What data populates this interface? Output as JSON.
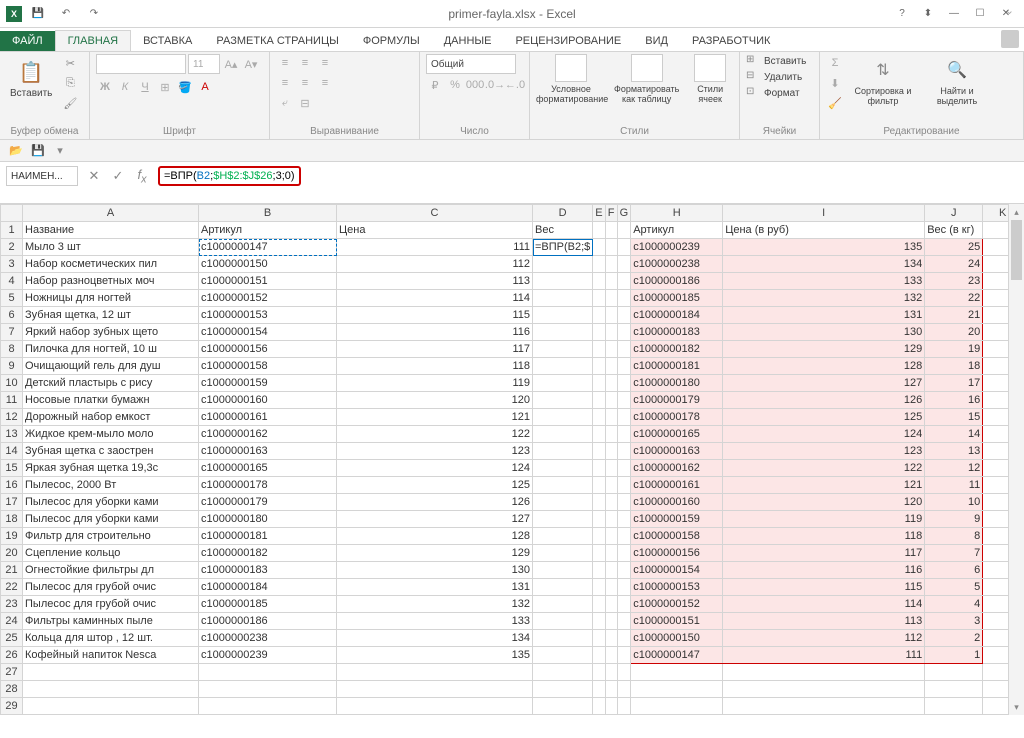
{
  "window": {
    "title": "primer-fayla.xlsx - Excel"
  },
  "tabs": {
    "file": "ФАЙЛ",
    "items": [
      "ГЛАВНАЯ",
      "ВСТАВКА",
      "РАЗМЕТКА СТРАНИЦЫ",
      "ФОРМУЛЫ",
      "ДАННЫЕ",
      "РЕЦЕНЗИРОВАНИЕ",
      "ВИД",
      "РАЗРАБОТЧИК"
    ],
    "active": 0
  },
  "ribbon": {
    "paste": "Вставить",
    "clipboard_label": "Буфер обмена",
    "font_label": "Шрифт",
    "font_size": "11",
    "align_label": "Выравнивание",
    "number_label": "Число",
    "number_format": "Общий",
    "styles_label": "Стили",
    "cond_fmt": "Условное форматирование",
    "fmt_table": "Форматировать как таблицу",
    "cell_styles": "Стили ячеек",
    "cells_label": "Ячейки",
    "insert": "Вставить",
    "delete": "Удалить",
    "format": "Формат",
    "edit_label": "Редактирование",
    "sort": "Сортировка и фильтр",
    "find": "Найти и выделить"
  },
  "formula_bar": {
    "name_box": "НАИМЕН...",
    "formula_prefix": "=ВПР(",
    "formula_arg1": "B2",
    "formula_sep1": ";",
    "formula_arg2": "$H$2:$J$26",
    "formula_sep2": ";",
    "formula_arg3": "3;0",
    "formula_suffix": ")"
  },
  "sheet": {
    "columns": [
      "A",
      "B",
      "C",
      "D",
      "E",
      "F",
      "G",
      "H",
      "I",
      "J",
      "K"
    ],
    "header_row": {
      "A": "Название",
      "B": "Артикул",
      "C": "Цена",
      "D": "Вес",
      "H": "Артикул",
      "I": "Цена (в руб)",
      "J": "Вес (в кг)"
    },
    "d2_display": "=ВПР(B2;$",
    "left_rows": [
      {
        "r": 2,
        "A": "Мыло 3 шт",
        "B": "c1000000147",
        "C": 111
      },
      {
        "r": 3,
        "A": "Набор косметических пил",
        "B": "c1000000150",
        "C": 112
      },
      {
        "r": 4,
        "A": "Набор разноцветных моч",
        "B": "c1000000151",
        "C": 113
      },
      {
        "r": 5,
        "A": "Ножницы для ногтей",
        "B": "c1000000152",
        "C": 114
      },
      {
        "r": 6,
        "A": "Зубная щетка, 12 шт",
        "B": "c1000000153",
        "C": 115
      },
      {
        "r": 7,
        "A": "Яркий набор зубных щето",
        "B": "c1000000154",
        "C": 116
      },
      {
        "r": 8,
        "A": "Пилочка для ногтей, 10 ш",
        "B": "c1000000156",
        "C": 117
      },
      {
        "r": 9,
        "A": "Очищающий гель для душ",
        "B": "c1000000158",
        "C": 118
      },
      {
        "r": 10,
        "A": "Детский пластырь с рису",
        "B": "c1000000159",
        "C": 119
      },
      {
        "r": 11,
        "A": "Носовые платки бумажн",
        "B": "c1000000160",
        "C": 120
      },
      {
        "r": 12,
        "A": "Дорожный набор емкост",
        "B": "c1000000161",
        "C": 121
      },
      {
        "r": 13,
        "A": "Жидкое крем-мыло моло",
        "B": "c1000000162",
        "C": 122
      },
      {
        "r": 14,
        "A": "Зубная щетка с заострен",
        "B": "c1000000163",
        "C": 123
      },
      {
        "r": 15,
        "A": "Яркая зубная щетка 19,3с",
        "B": "c1000000165",
        "C": 124
      },
      {
        "r": 16,
        "A": "Пылесос, 2000 Вт",
        "B": "c1000000178",
        "C": 125
      },
      {
        "r": 17,
        "A": "Пылесос для уборки ками",
        "B": "c1000000179",
        "C": 126
      },
      {
        "r": 18,
        "A": "Пылесос для уборки ками",
        "B": "c1000000180",
        "C": 127
      },
      {
        "r": 19,
        "A": "Фильтр для строительно",
        "B": "c1000000181",
        "C": 128
      },
      {
        "r": 20,
        "A": "Сцепление кольцо",
        "B": "c1000000182",
        "C": 129
      },
      {
        "r": 21,
        "A": "Огнестойкие фильтры дл",
        "B": "c1000000183",
        "C": 130
      },
      {
        "r": 22,
        "A": "Пылесос для грубой очис",
        "B": "c1000000184",
        "C": 131
      },
      {
        "r": 23,
        "A": "Пылесос для грубой очис",
        "B": "c1000000185",
        "C": 132
      },
      {
        "r": 24,
        "A": "Фильтры каминных пыле",
        "B": "c1000000186",
        "C": 133
      },
      {
        "r": 25,
        "A": "Кольца для штор , 12 шт.",
        "B": "c1000000238",
        "C": 134
      },
      {
        "r": 26,
        "A": "Кофейный напиток Nesca",
        "B": "c1000000239",
        "C": 135
      }
    ],
    "right_rows": [
      {
        "r": 2,
        "H": "c1000000239",
        "I": 135,
        "J": 25
      },
      {
        "r": 3,
        "H": "c1000000238",
        "I": 134,
        "J": 24
      },
      {
        "r": 4,
        "H": "c1000000186",
        "I": 133,
        "J": 23
      },
      {
        "r": 5,
        "H": "c1000000185",
        "I": 132,
        "J": 22
      },
      {
        "r": 6,
        "H": "c1000000184",
        "I": 131,
        "J": 21
      },
      {
        "r": 7,
        "H": "c1000000183",
        "I": 130,
        "J": 20
      },
      {
        "r": 8,
        "H": "c1000000182",
        "I": 129,
        "J": 19
      },
      {
        "r": 9,
        "H": "c1000000181",
        "I": 128,
        "J": 18
      },
      {
        "r": 10,
        "H": "c1000000180",
        "I": 127,
        "J": 17
      },
      {
        "r": 11,
        "H": "c1000000179",
        "I": 126,
        "J": 16
      },
      {
        "r": 12,
        "H": "c1000000178",
        "I": 125,
        "J": 15
      },
      {
        "r": 13,
        "H": "c1000000165",
        "I": 124,
        "J": 14
      },
      {
        "r": 14,
        "H": "c1000000163",
        "I": 123,
        "J": 13
      },
      {
        "r": 15,
        "H": "c1000000162",
        "I": 122,
        "J": 12
      },
      {
        "r": 16,
        "H": "c1000000161",
        "I": 121,
        "J": 11
      },
      {
        "r": 17,
        "H": "c1000000160",
        "I": 120,
        "J": 10
      },
      {
        "r": 18,
        "H": "c1000000159",
        "I": 119,
        "J": 9
      },
      {
        "r": 19,
        "H": "c1000000158",
        "I": 118,
        "J": 8
      },
      {
        "r": 20,
        "H": "c1000000156",
        "I": 117,
        "J": 7
      },
      {
        "r": 21,
        "H": "c1000000154",
        "I": 116,
        "J": 6
      },
      {
        "r": 22,
        "H": "c1000000153",
        "I": 115,
        "J": 5
      },
      {
        "r": 23,
        "H": "c1000000152",
        "I": 114,
        "J": 4
      },
      {
        "r": 24,
        "H": "c1000000151",
        "I": 113,
        "J": 3
      },
      {
        "r": 25,
        "H": "c1000000150",
        "I": 112,
        "J": 2
      },
      {
        "r": 26,
        "H": "c1000000147",
        "I": 111,
        "J": 1
      }
    ],
    "extra_rows": [
      27,
      28,
      29
    ]
  }
}
